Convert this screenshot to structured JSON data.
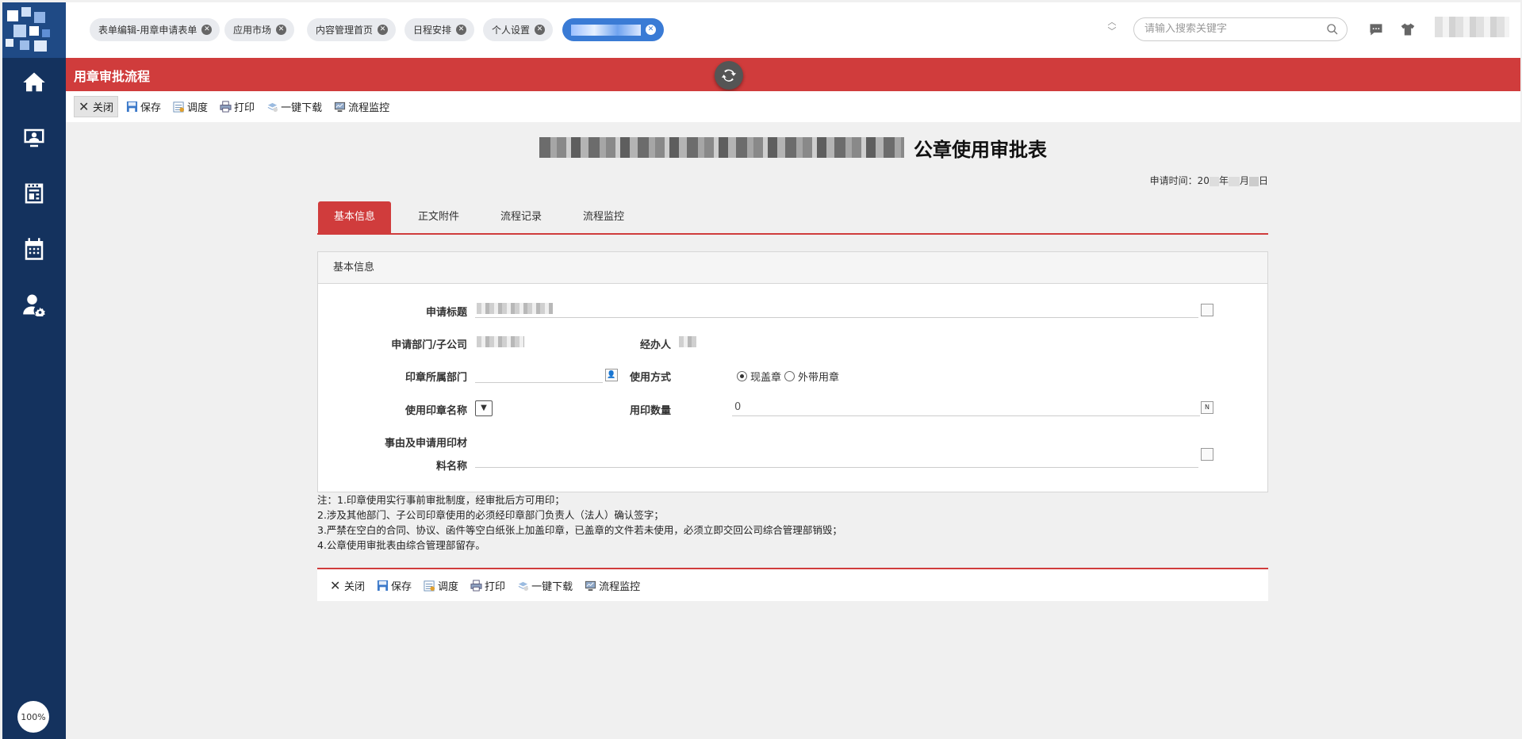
{
  "nav": {
    "items": [
      {
        "name": "home-icon"
      },
      {
        "name": "user-screen-icon"
      },
      {
        "name": "news-icon"
      },
      {
        "name": "calendar-icon"
      },
      {
        "name": "user-settings-icon"
      }
    ],
    "zoom": "100%"
  },
  "tabs": [
    {
      "label": "表单编辑-用章申请表单"
    },
    {
      "label": "应用市场"
    },
    {
      "label": "内容管理首页"
    },
    {
      "label": "日程安排"
    },
    {
      "label": "个人设置"
    }
  ],
  "search": {
    "placeholder": "请输入搜索关键字"
  },
  "header": {
    "title": "用章审批流程"
  },
  "toolbar": {
    "close": "关闭",
    "save": "保存",
    "adjust": "调度",
    "print": "打印",
    "download": "一键下载",
    "monitor": "流程监控"
  },
  "form": {
    "title": "公章使用审批表",
    "apply_time_label": "申请时间：",
    "apply_time_parts": {
      "year_prefix": "20",
      "year": "年",
      "month": "月",
      "day": "日"
    },
    "tabs": [
      "基本信息",
      "正文附件",
      "流程记录",
      "流程监控"
    ],
    "section_title": "基本信息",
    "labels": {
      "apply_title": "申请标题",
      "department": "申请部门/子公司",
      "handler": "经办人",
      "seal_department": "印章所属部门",
      "usage_mode": "使用方式",
      "seal_name": "使用印章名称",
      "quantity": "用印数量",
      "reason_line1": "事由及申请用印材",
      "reason_line2": "料名称"
    },
    "usage_options": {
      "on_site": "现盖章",
      "take_out": "外带用章"
    },
    "quantity_value": "0"
  },
  "notes": [
    "注：1.印章使用实行事前审批制度，经审批后方可用印；",
    "2.涉及其他部门、子公司印章使用的必须经印章部门负责人（法人）确认签字；",
    "3.严禁在空白的合同、协议、函件等空白纸张上加盖印章，已盖章的文件若未使用，必须立即交回公司综合管理部销毁；",
    "4.公章使用审批表由综合管理部留存。"
  ],
  "colors": {
    "accent_red": "#d03c3c",
    "nav_blue": "#14325e",
    "tab_active": "#3a7bd5"
  }
}
